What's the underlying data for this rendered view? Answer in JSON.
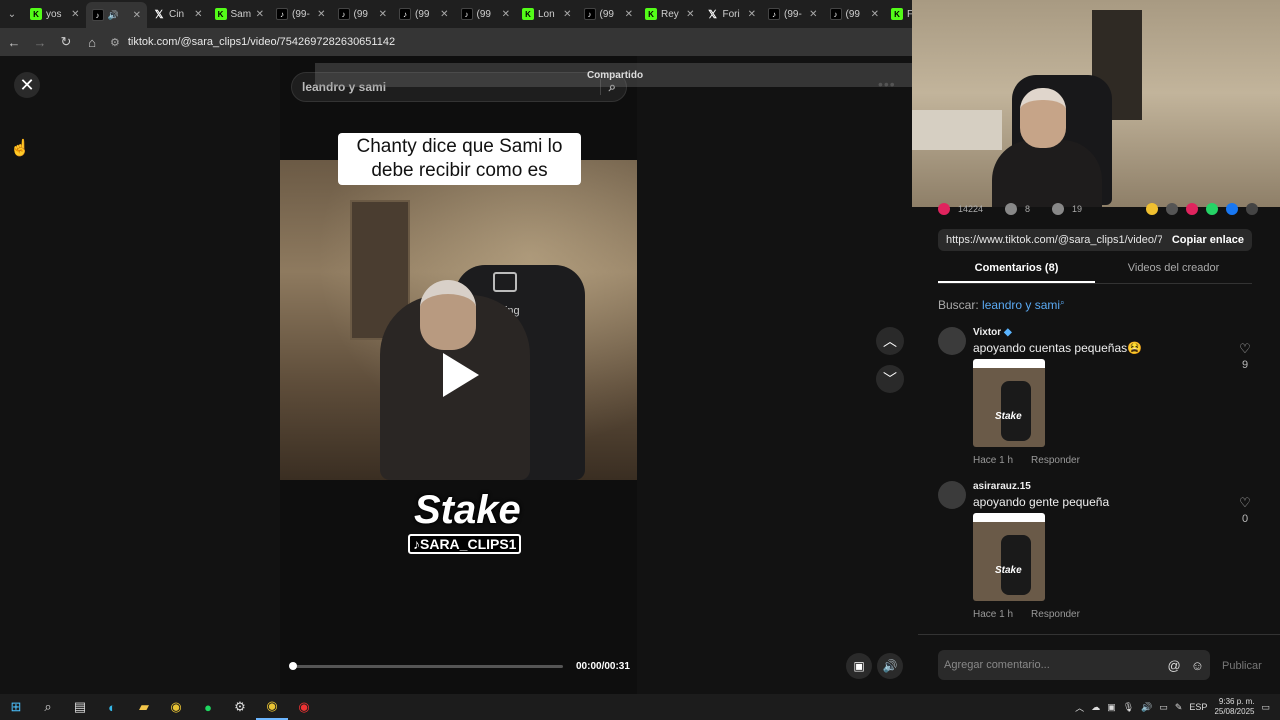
{
  "browser": {
    "tabs": [
      {
        "icon": "K",
        "icon_type": "kick",
        "label": "yos"
      },
      {
        "icon": "♪",
        "icon_type": "tiktok",
        "label": "",
        "active": true
      },
      {
        "icon": "𝕏",
        "icon_type": "x",
        "label": "Cin"
      },
      {
        "icon": "K",
        "icon_type": "kick",
        "label": "Sam"
      },
      {
        "icon": "♪",
        "icon_type": "tiktok",
        "label": "(99-"
      },
      {
        "icon": "♪",
        "icon_type": "tiktok",
        "label": "(99"
      },
      {
        "icon": "♪",
        "icon_type": "tiktok",
        "label": "(99"
      },
      {
        "icon": "♪",
        "icon_type": "tiktok",
        "label": "(99"
      },
      {
        "icon": "K",
        "icon_type": "kick",
        "label": "Lon"
      },
      {
        "icon": "♪",
        "icon_type": "tiktok",
        "label": "(99"
      },
      {
        "icon": "K",
        "icon_type": "kick",
        "label": "Rey"
      },
      {
        "icon": "𝕏",
        "icon_type": "x",
        "label": "Fori"
      },
      {
        "icon": "♪",
        "icon_type": "tiktok",
        "label": "(99-"
      },
      {
        "icon": "♪",
        "icon_type": "tiktok",
        "label": "(99"
      },
      {
        "icon": "K",
        "icon_type": "kick",
        "label": "F"
      }
    ],
    "url": "tiktok.com/@sara_clips1/video/7542697282630651142"
  },
  "player": {
    "search_text": "leandro y sami",
    "shared_banner": "Compartido",
    "caption": "Chanty dice que Sami lo debe recibir como es",
    "watermark_brand": "Stake",
    "watermark_handle": "SARA_CLIPS1",
    "chair_brand": "stgaming",
    "time": "00:00/00:31",
    "progress": 0.0
  },
  "panel": {
    "stats": [
      "14224",
      "8",
      "19"
    ],
    "link": "https://www.tiktok.com/@sara_clips1/video/7542...",
    "copy_label": "Copiar enlace",
    "tabs": [
      "Comentarios (8)",
      "Videos del creador"
    ],
    "search_prefix": "Buscar:",
    "search_query": "leandro y sami",
    "comments": [
      {
        "user": "Vixtor",
        "text": "apoyando cuentas pequeñas😫",
        "time": "Hace 1 h",
        "reply": "Responder",
        "likes": "9"
      },
      {
        "user": "asirarauz.15",
        "text": "apoyando gente pequeña",
        "time": "Hace 1 h",
        "reply": "Responder",
        "likes": "0"
      }
    ],
    "add_comment_placeholder": "Agregar comentario...",
    "publish_label": "Publicar"
  },
  "taskbar": {
    "lang": "ESP",
    "time": "9:36 p. m.",
    "date": "25/08/2025"
  },
  "colors": {
    "kick_green": "#53fc18",
    "link_blue": "#5aa9f2"
  }
}
